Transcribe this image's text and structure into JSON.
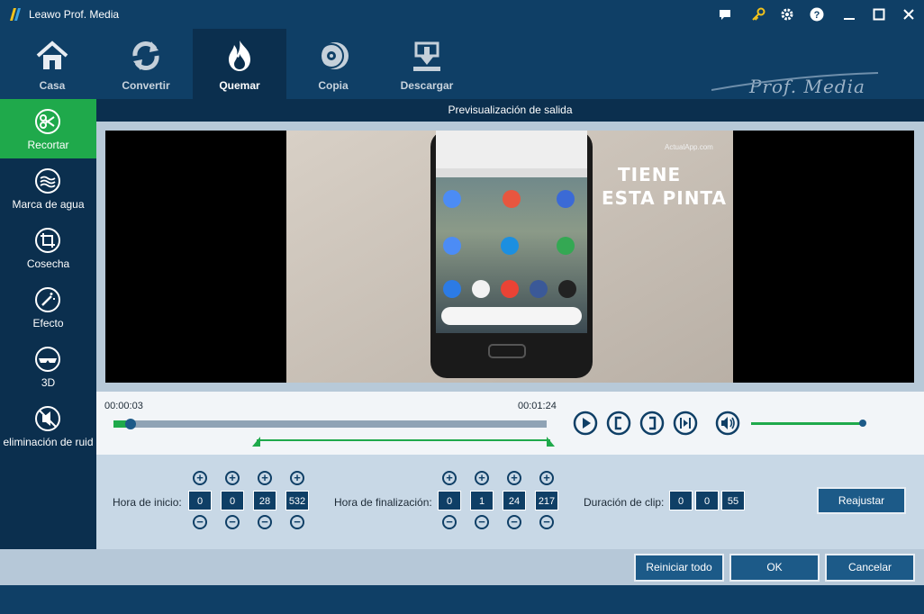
{
  "app": {
    "title": "Leawo Prof. Media",
    "brand": "Prof. Media"
  },
  "window_controls": [
    "chat-icon",
    "key-icon",
    "gear-icon",
    "help-icon",
    "minimize-icon",
    "maximize-icon",
    "close-icon"
  ],
  "nav": {
    "items": [
      {
        "label": "Casa",
        "icon": "home-icon"
      },
      {
        "label": "Convertir",
        "icon": "convert-icon"
      },
      {
        "label": "Quemar",
        "icon": "burn-icon",
        "active": true
      },
      {
        "label": "Copia",
        "icon": "copy-icon"
      },
      {
        "label": "Descargar",
        "icon": "download-icon"
      }
    ]
  },
  "sidebar": {
    "items": [
      {
        "label": "Recortar",
        "icon": "scissors-icon",
        "active": true
      },
      {
        "label": "Marca de agua",
        "icon": "watermark-icon"
      },
      {
        "label": "Cosecha",
        "icon": "crop-icon"
      },
      {
        "label": "Efecto",
        "icon": "magic-wand-icon"
      },
      {
        "label": "3D",
        "icon": "3d-glasses-icon"
      },
      {
        "label": "eliminación de ruid",
        "icon": "noise-removal-icon"
      }
    ]
  },
  "preview": {
    "title": "Previsualización de salida",
    "overlay_text_line1": "TIENE",
    "overlay_text_line2": "ESTA PINTA",
    "watermark": "ActualApp.com"
  },
  "timeline": {
    "start_time": "00:00:03",
    "end_time": "00:01:24",
    "playhead_fraction": 0.04,
    "volume_fraction": 1.0
  },
  "trim": {
    "start_label": "Hora de inicio:",
    "start_values": [
      "0",
      "0",
      "28",
      "532"
    ],
    "end_label": "Hora de finalización:",
    "end_values": [
      "0",
      "1",
      "24",
      "217"
    ],
    "duration_label": "Duración de clip:",
    "duration_values": [
      "0",
      "0",
      "55"
    ],
    "readjust_label": "Reajustar"
  },
  "footer": {
    "reset_label": "Reiniciar todo",
    "ok_label": "OK",
    "cancel_label": "Cancelar"
  },
  "colors": {
    "accent_green": "#1fa94b",
    "primary_dark": "#0f3f66",
    "button_blue": "#1c5a88"
  }
}
